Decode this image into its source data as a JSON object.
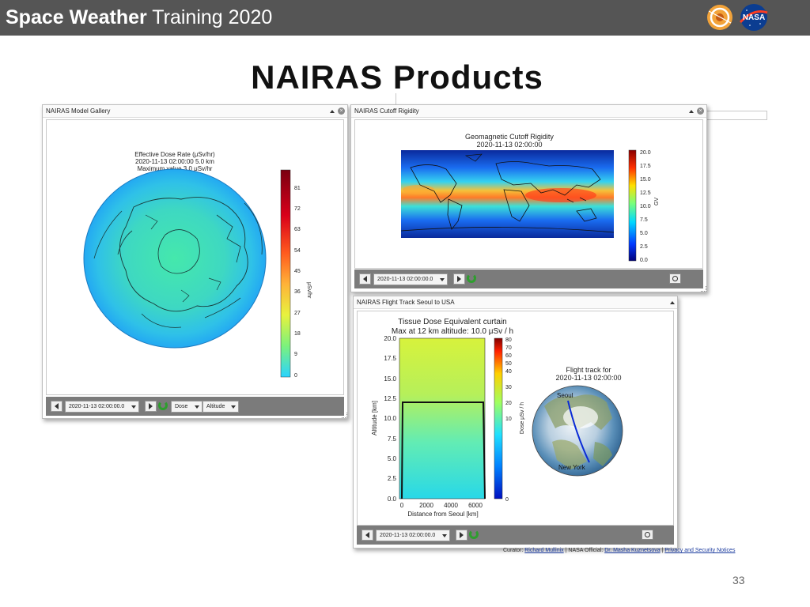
{
  "header": {
    "title_bold": "Space Weather",
    "title_rest": "Training 2020",
    "logo_text": "NASA"
  },
  "slide_title": "NAIRAS Products",
  "windows": {
    "model_gallery": {
      "title": "NAIRAS Model Gallery",
      "plot": {
        "title_lines": [
          "Effective Dose Rate (μSv/hr)",
          "2020-11-13 02:00:00 5.0 km",
          "Maximum value 3.0 μSv/hr"
        ],
        "colorbar_ticks": [
          "81",
          "72",
          "63",
          "54",
          "45",
          "36",
          "27",
          "18",
          "9",
          "0"
        ],
        "colorbar_label": "μSv/hr"
      },
      "controls": {
        "date": "2020-11-13 02:00:00.0",
        "dose": "Dose",
        "altitude": "Altitude"
      }
    },
    "cutoff_rigidity": {
      "title": "NAIRAS Cutoff Rigidity",
      "plot": {
        "title_lines": [
          "Geomagnetic Cutoff Rigidity",
          "2020-11-13 02:00:00"
        ],
        "colorbar_ticks": [
          "20.0",
          "17.5",
          "15.0",
          "12.5",
          "10.0",
          "7.5",
          "5.0",
          "2.5",
          "0.0"
        ],
        "colorbar_label": "GV"
      },
      "controls": {
        "date": "2020-11-13 02:00:00.0"
      }
    },
    "flight_track": {
      "title": "NAIRAS Flight Track Seoul to USA",
      "curtain": {
        "title_lines": [
          "Tissue Dose Equivalent curtain",
          "Max at 12 km altitude: 10.0 μSv / h"
        ],
        "xlabel": "Distance from Seoul [km]",
        "ylabel": "Altitude [km]",
        "y_ticks": [
          "20.0",
          "17.5",
          "15.0",
          "12.5",
          "10.0",
          "7.5",
          "5.0",
          "2.5",
          "0.0"
        ],
        "x_ticks": [
          "0",
          "2000",
          "4000",
          "6000"
        ],
        "colorbar_ticks": [
          "80",
          "70",
          "60",
          "50",
          "40",
          "30",
          "20",
          "10",
          "0"
        ],
        "colorbar_label": "Dose μSv / h"
      },
      "globe": {
        "title_lines": [
          "Flight track for",
          "2020-11-13 02:00:00"
        ],
        "label_start": "Seoul",
        "label_end": "New York"
      },
      "controls": {
        "date": "2020-11-13 02:00:00.0"
      }
    }
  },
  "footer": {
    "curator_label": "Curator:",
    "curator_name": "Richard Mullinix",
    "official_label": "NASA Official:",
    "official_name": "Dr. Masha Kuznetsova",
    "privacy": "Privacy and Security Notices"
  },
  "page_number": "33"
}
